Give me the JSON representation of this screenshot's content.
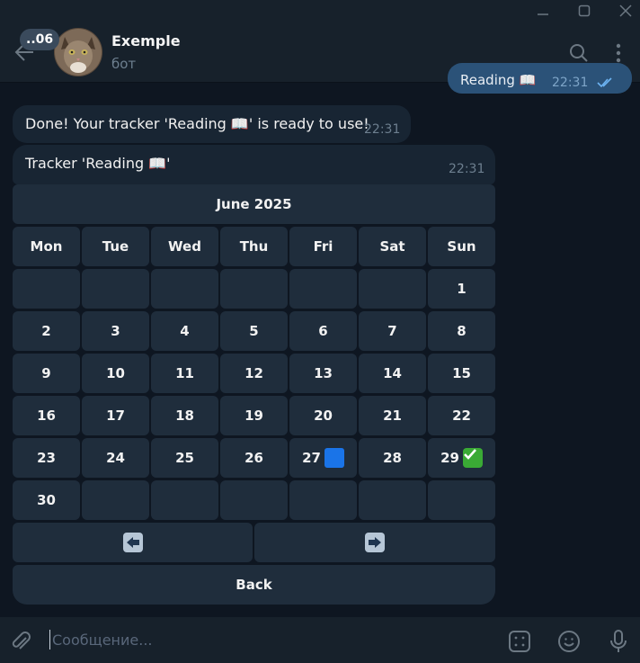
{
  "window": {
    "controls": [
      "minimize-icon",
      "maximize-icon",
      "close-icon"
    ]
  },
  "header": {
    "unread_badge": "..06",
    "chat_name": "Exemple",
    "chat_status": "бот"
  },
  "messages": {
    "outgoing": {
      "text": "Reading 📖",
      "time": "22:31"
    },
    "incoming": [
      {
        "text": "Done! Your tracker 'Reading 📖' is ready to use!",
        "time": "22:31"
      },
      {
        "text": "Tracker 'Reading 📖'",
        "time": "22:31"
      }
    ]
  },
  "calendar": {
    "month_label": "June 2025",
    "weekdays": [
      "Mon",
      "Tue",
      "Wed",
      "Thu",
      "Fri",
      "Sat",
      "Sun"
    ],
    "weeks": [
      [
        "",
        "",
        "",
        "",
        "",
        "",
        "1"
      ],
      [
        "2",
        "3",
        "4",
        "5",
        "6",
        "7",
        "8"
      ],
      [
        "9",
        "10",
        "11",
        "12",
        "13",
        "14",
        "15"
      ],
      [
        "16",
        "17",
        "18",
        "19",
        "20",
        "21",
        "22"
      ],
      [
        "23",
        "24",
        "25",
        "26",
        "27",
        "28",
        "29"
      ],
      [
        "30",
        "",
        "",
        "",
        "",
        "",
        ""
      ]
    ],
    "marked_days": {
      "27": "blue-square",
      "29": "green-check"
    },
    "nav": {
      "prev_icon": "left-arrow-icon",
      "next_icon": "right-arrow-icon"
    },
    "back_label": "Back"
  },
  "compose": {
    "placeholder": "Сообщение..."
  },
  "colors": {
    "bg": "#0e1621",
    "bubble": "#182533",
    "outgoing": "#2b5278",
    "button": "#1f2d3c"
  }
}
